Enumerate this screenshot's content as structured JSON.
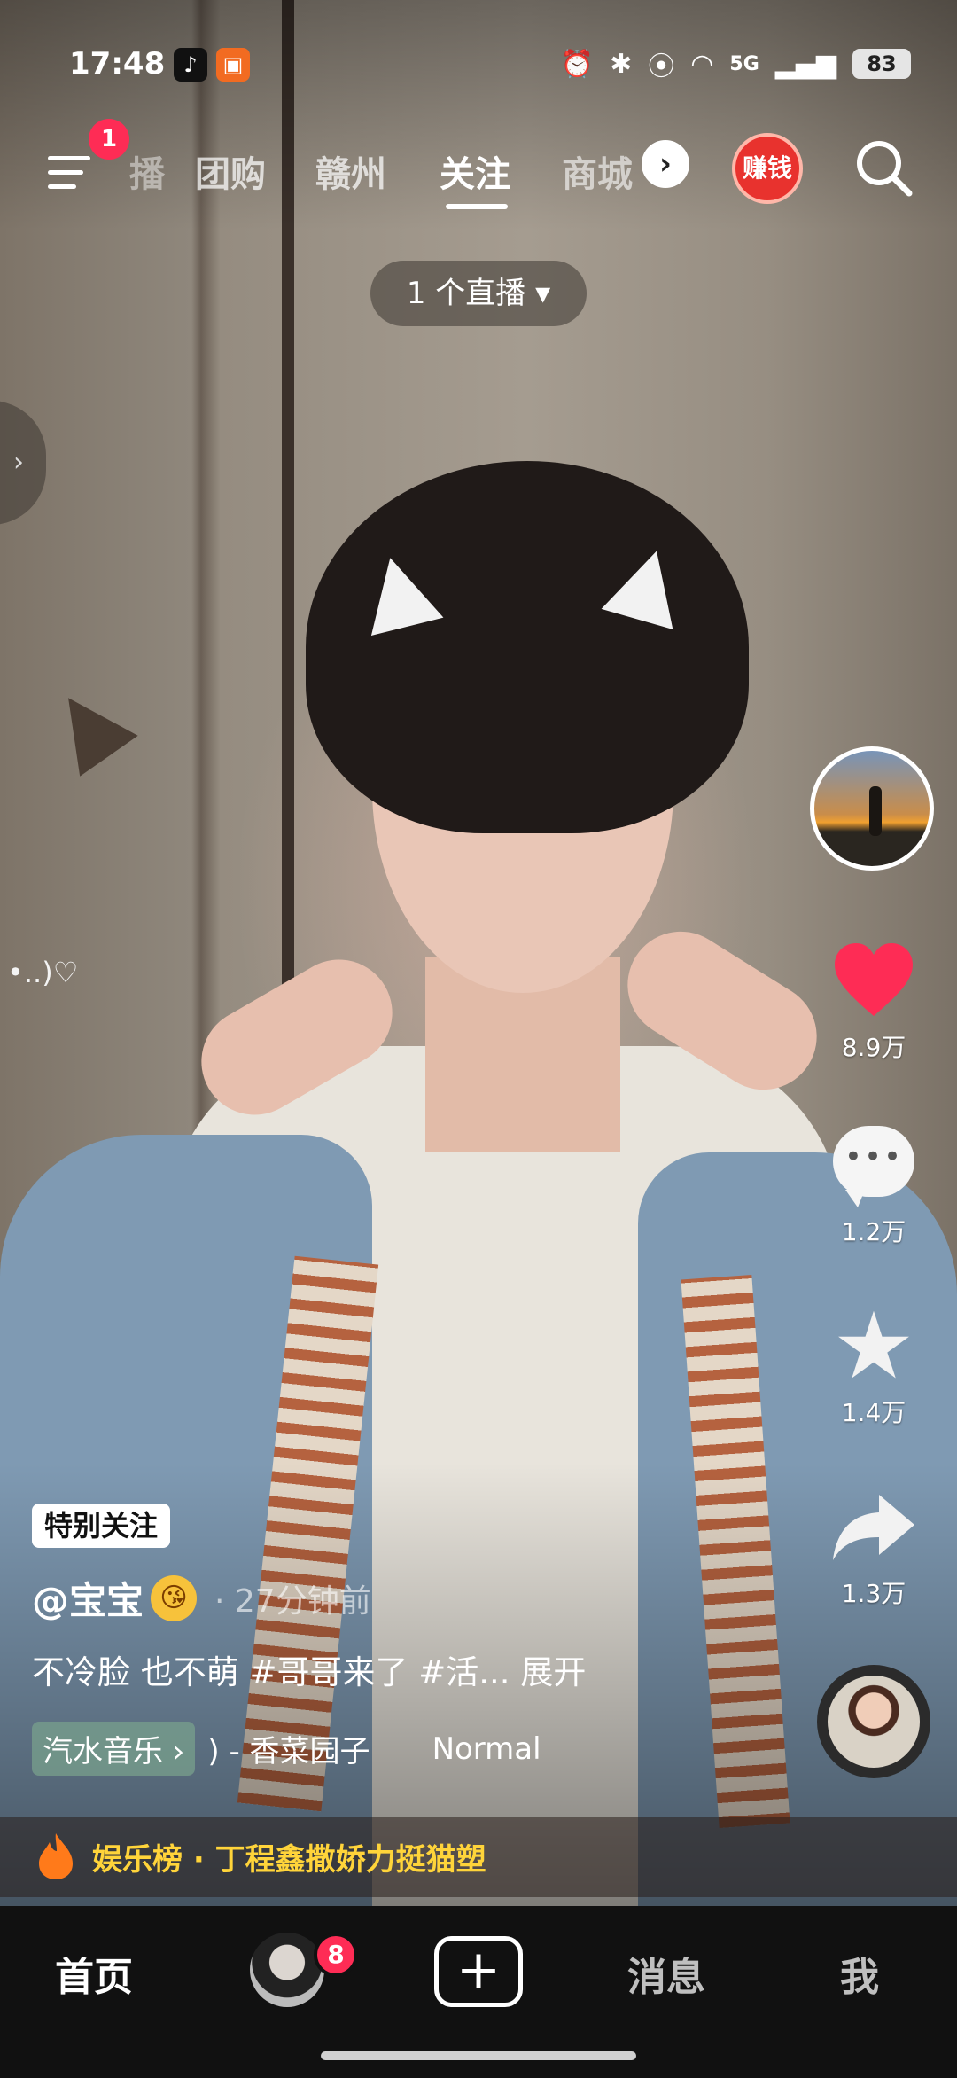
{
  "status_bar": {
    "time": "17:48",
    "network": "5G",
    "battery": "83",
    "app_icons": [
      "tiktok-icon",
      "app-icon"
    ]
  },
  "top_nav": {
    "menu_badge": "1",
    "tabs": [
      {
        "label": "播",
        "active": false
      },
      {
        "label": "团购",
        "active": false
      },
      {
        "label": "赣州",
        "active": false
      },
      {
        "label": "关注",
        "active": true
      },
      {
        "label": "商城",
        "active": false
      }
    ],
    "more_symbol": "›",
    "earn_label": "赚钱"
  },
  "live_pill": "1 个直播 ▾",
  "side_handle": "›",
  "doodle_text": "•..)♡",
  "actions": {
    "likes": "8.9万",
    "comments": "1.2万",
    "favorites": "1.4万",
    "shares": "1.3万",
    "comment_dots": "•••",
    "star_symbol": "★"
  },
  "post": {
    "badge": "特别关注",
    "author": "@宝宝",
    "author_emoji": "😘",
    "time": "· 27分钟前",
    "description": "不冷脸 也不萌 #哥哥来了 #活... 展开",
    "music_tag": "汽水音乐 ›",
    "music_title": ") - 香菜园子",
    "music_extra": "Normal"
  },
  "hot_bar": {
    "text": "娱乐榜 · 丁程鑫撒娇力挺猫塑"
  },
  "bottom_tabs": {
    "home": "首页",
    "friends_badge": "8",
    "plus": "+",
    "messages": "消息",
    "me": "我"
  },
  "colors": {
    "accent": "#fe2c55",
    "hot_text": "#ffd43a",
    "tabbar_bg": "#111111"
  }
}
